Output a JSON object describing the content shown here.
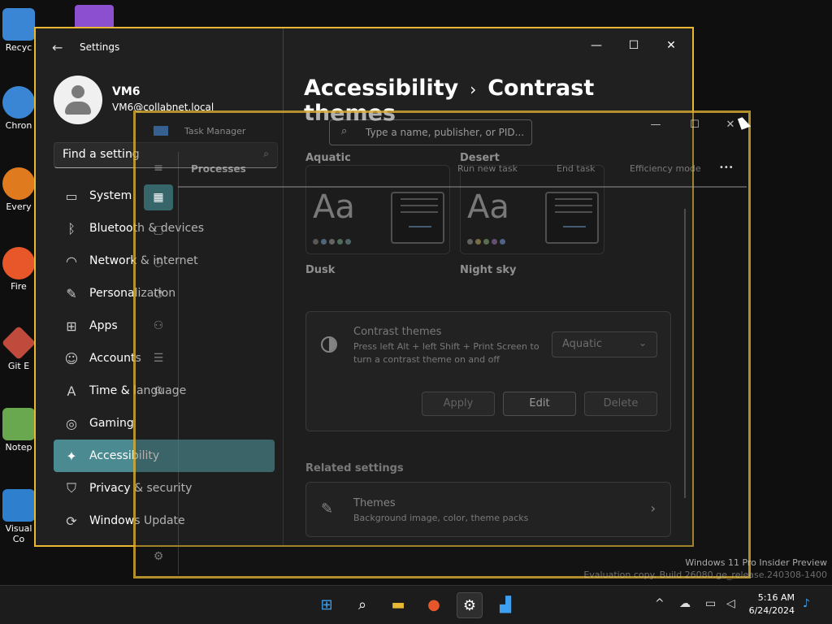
{
  "desktop": {
    "icons": [
      {
        "label": "Recyc",
        "icon": "recycle-bin-icon",
        "color": "#3b86d4"
      },
      {
        "label": "Chron",
        "icon": "chrome-icon",
        "color": "#3b86d4"
      },
      {
        "label": "Every",
        "icon": "everything-icon",
        "color": "#e07a1f"
      },
      {
        "label": "Fire",
        "icon": "firefox-icon",
        "color": "#e8572a"
      },
      {
        "label": "Git E",
        "icon": "git-icon",
        "color": "#c04b3c"
      },
      {
        "label": "Notep",
        "icon": "notepad-icon",
        "color": "#6aa84f"
      },
      {
        "label": "Visual Co",
        "icon": "vscode-icon",
        "color": "#2f7fcf"
      }
    ]
  },
  "settings": {
    "app_title": "Settings",
    "user_name": "VM6",
    "user_email": "VM6@collabnet.local",
    "search_placeholder": "Find a setting",
    "nav": [
      {
        "label": "System",
        "icon": "monitor-icon"
      },
      {
        "label": "Bluetooth & devices",
        "icon": "bluetooth-icon"
      },
      {
        "label": "Network & internet",
        "icon": "wifi-icon"
      },
      {
        "label": "Personalization",
        "icon": "brush-icon"
      },
      {
        "label": "Apps",
        "icon": "apps-icon"
      },
      {
        "label": "Accounts",
        "icon": "person-icon"
      },
      {
        "label": "Time & language",
        "icon": "language-icon"
      },
      {
        "label": "Gaming",
        "icon": "gamepad-icon"
      },
      {
        "label": "Accessibility",
        "icon": "accessibility-icon",
        "active": true
      },
      {
        "label": "Privacy & security",
        "icon": "shield-icon"
      },
      {
        "label": "Windows Update",
        "icon": "update-icon"
      }
    ],
    "breadcrumb_parent": "Accessibility",
    "breadcrumb_sep": "›",
    "breadcrumb_current": "Contrast themes",
    "themes": {
      "aquatic": "Aquatic",
      "desert": "Desert",
      "dusk": "Dusk",
      "night_sky": "Night sky",
      "aa": "Aa"
    },
    "contrast": {
      "title": "Contrast themes",
      "description": "Press left Alt + left Shift + Print Screen to turn a contrast theme on and off",
      "selected": "Aquatic",
      "apply": "Apply",
      "edit": "Edit",
      "delete": "Delete"
    },
    "related_heading": "Related settings",
    "themes_row": {
      "title": "Themes",
      "subtitle": "Background image, color, theme packs"
    }
  },
  "taskmanager": {
    "title": "Task Manager",
    "search_placeholder": "Type a name, publisher, or PID...",
    "processes": "Processes",
    "run_new_task": "Run new task",
    "end_task": "End task",
    "efficiency_mode": "Efficiency mode",
    "more": "•••"
  },
  "watermark": {
    "line1": "Windows 11 Pro Insider Preview",
    "line2": "Evaluation copy. Build 26080.ge_release.240308-1400"
  },
  "taskbar": {
    "time": "5:16 AM",
    "date": "6/24/2024"
  },
  "colors": {
    "accent": "#4a8a90",
    "window_border": "#e8b833"
  }
}
